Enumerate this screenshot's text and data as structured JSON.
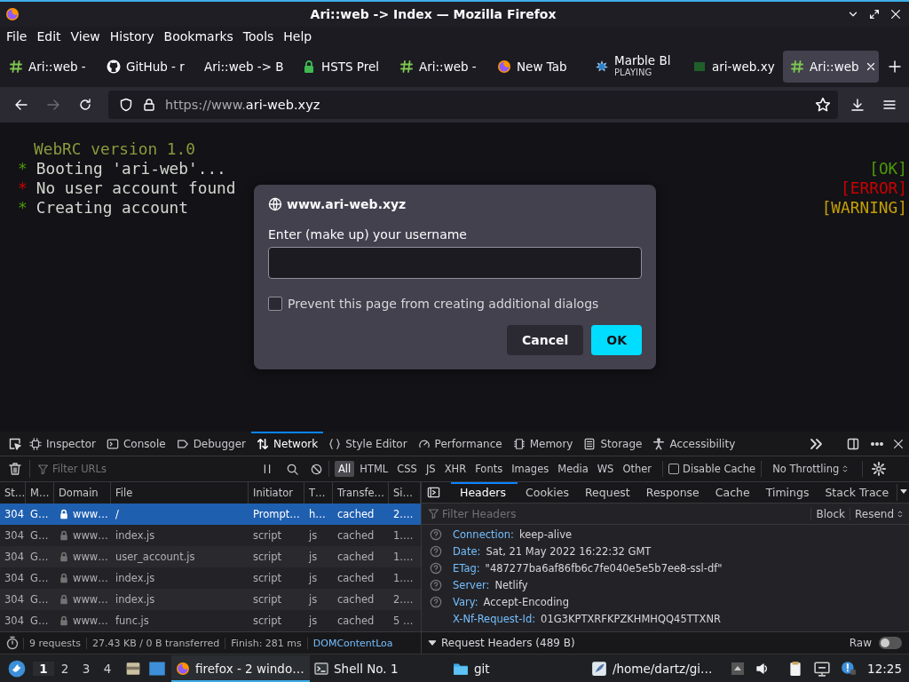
{
  "window": {
    "title": "Ari::web -> Index — Mozilla Firefox"
  },
  "menu": [
    "File",
    "Edit",
    "View",
    "History",
    "Bookmarks",
    "Tools",
    "Help"
  ],
  "tabs": [
    {
      "label": "Ari::web -",
      "kind": "hash",
      "selected": false
    },
    {
      "label": "GitHub - r",
      "kind": "github",
      "selected": false
    },
    {
      "label": "Ari::web -> B",
      "kind": "plain",
      "selected": false
    },
    {
      "label": "HSTS Prel",
      "kind": "lock",
      "selected": false
    },
    {
      "label": "Ari::web -",
      "kind": "hash",
      "selected": false
    },
    {
      "label": "New Tab",
      "kind": "firefox",
      "selected": false
    },
    {
      "label": "Marble Bl",
      "sublabel": "PLAYING",
      "kind": "marble",
      "selected": false
    },
    {
      "label": "ari-web.xy",
      "kind": "square",
      "selected": false
    },
    {
      "label": "Ari::web",
      "kind": "hash",
      "selected": true
    }
  ],
  "address": {
    "prefix": "https://www.",
    "host": "ari-web.xyz"
  },
  "console": {
    "heading": "WebRC version 1.0",
    "lines": [
      {
        "bullet": "*",
        "kind": "ok",
        "text": "Booting 'ari-web'...",
        "status": "[OK]",
        "color": "#4e9a06"
      },
      {
        "bullet": "*",
        "kind": "error",
        "text": "No user account found",
        "status": "[ERROR]",
        "color": "#cc0000"
      },
      {
        "bullet": "*",
        "kind": "ok",
        "text": "Creating account",
        "status": "[WARNING]",
        "color": "#c4a000"
      }
    ]
  },
  "dialog": {
    "origin": "www.ari-web.xyz",
    "label": "Enter (make up) your username",
    "checkbox": {
      "label": "Prevent this page from creating additional dialogs",
      "checked": false
    },
    "buttons": [
      {
        "label": "Cancel",
        "kind": "secondary"
      },
      {
        "label": "OK",
        "kind": "primary"
      }
    ]
  },
  "devtools": {
    "tabs": [
      {
        "label": "Inspector",
        "kind": "inspector",
        "selected": false
      },
      {
        "label": "Console",
        "kind": "console",
        "selected": false
      },
      {
        "label": "Debugger",
        "kind": "debugger",
        "selected": false
      },
      {
        "label": "Network",
        "kind": "network",
        "selected": true
      },
      {
        "label": "Style Editor",
        "kind": "style",
        "selected": false
      },
      {
        "label": "Performance",
        "kind": "performance",
        "selected": false
      },
      {
        "label": "Memory",
        "kind": "memory",
        "selected": false
      },
      {
        "label": "Storage",
        "kind": "storage",
        "selected": false
      },
      {
        "label": "Accessibility",
        "kind": "accessibility",
        "selected": false
      }
    ],
    "network": {
      "filter": {
        "placeholder": "Filter URLs"
      },
      "types": [
        {
          "label": "All",
          "selected": true
        },
        {
          "label": "HTML",
          "selected": false
        },
        {
          "label": "CSS",
          "selected": false
        },
        {
          "label": "JS",
          "selected": false
        },
        {
          "label": "XHR",
          "selected": false
        },
        {
          "label": "Fonts",
          "selected": false
        },
        {
          "label": "Images",
          "selected": false
        },
        {
          "label": "Media",
          "selected": false
        },
        {
          "label": "WS",
          "selected": false
        },
        {
          "label": "Other",
          "selected": false
        }
      ],
      "disable_cache": {
        "label": "Disable Cache",
        "checked": false
      },
      "throttling": "No Throttling",
      "columns": [
        "St…",
        "M…",
        "Domain",
        "File",
        "Initiator",
        "T…",
        "Transfe…",
        "Si…"
      ],
      "rows": [
        {
          "status": "304",
          "method": "G…",
          "domain": "www…",
          "file": "/",
          "initiator": "Prompt…",
          "type": "h…",
          "transferred": "cached",
          "size": "2.…",
          "selected": true
        },
        {
          "status": "304",
          "method": "G…",
          "domain": "www…",
          "file": "index.js",
          "initiator": "script",
          "type": "js",
          "transferred": "cached",
          "size": "1.…",
          "selected": false
        },
        {
          "status": "304",
          "method": "G…",
          "domain": "www…",
          "file": "user_account.js",
          "initiator": "script",
          "type": "js",
          "transferred": "cached",
          "size": "1.…",
          "selected": false
        },
        {
          "status": "304",
          "method": "G…",
          "domain": "www…",
          "file": "index.js",
          "initiator": "script",
          "type": "js",
          "transferred": "cached",
          "size": "1.…",
          "selected": false
        },
        {
          "status": "304",
          "method": "G…",
          "domain": "www…",
          "file": "index.js",
          "initiator": "script",
          "type": "js",
          "transferred": "cached",
          "size": "2.…",
          "selected": false
        },
        {
          "status": "304",
          "method": "G…",
          "domain": "www…",
          "file": "func.js",
          "initiator": "script",
          "type": "js",
          "transferred": "cached",
          "size": "5 …",
          "selected": false
        }
      ],
      "summary": [
        "9 requests",
        "27.43 KB / 0 B transferred",
        "Finish: 281 ms",
        "DOMContentLoa"
      ],
      "details": {
        "tabs": [
          {
            "label": "Headers",
            "selected": true
          },
          {
            "label": "Cookies",
            "selected": false
          },
          {
            "label": "Request",
            "selected": false
          },
          {
            "label": "Response",
            "selected": false
          },
          {
            "label": "Cache",
            "selected": false
          },
          {
            "label": "Timings",
            "selected": false
          },
          {
            "label": "Stack Trace",
            "selected": false
          }
        ],
        "filter": {
          "placeholder": "Filter Headers"
        },
        "actions": [
          "Block",
          "Resend"
        ],
        "headers": [
          {
            "name": "Connection:",
            "value": "keep-alive",
            "help": true
          },
          {
            "name": "Date:",
            "value": "Sat, 21 May 2022 16:22:32 GMT",
            "help": true
          },
          {
            "name": "ETag:",
            "value": "\"487277ba6af86fb6c7fe040e5e5b7ee8-ssl-df\"",
            "help": true
          },
          {
            "name": "Server:",
            "value": "Netlify",
            "help": true
          },
          {
            "name": "Vary:",
            "value": "Accept-Encoding",
            "help": true
          },
          {
            "name": "X-Nf-Request-Id:",
            "value": "01G3KPTXRFKPZKHMHQQ45TTXNR",
            "help": false
          }
        ],
        "section": "Request Headers (489 B)",
        "raw": {
          "label": "Raw",
          "on": false
        }
      }
    }
  },
  "taskbar": {
    "workspaces": [
      {
        "label": "1",
        "selected": true
      },
      {
        "label": "2",
        "selected": false
      },
      {
        "label": "3",
        "selected": false
      },
      {
        "label": "4",
        "selected": false
      }
    ],
    "tasks": [
      {
        "label": "firefox - 2 windo…",
        "kind": "firefox",
        "selected": true
      },
      {
        "label": "Shell No. 1",
        "kind": "terminal",
        "selected": false
      },
      {
        "label": "git",
        "kind": "folder",
        "selected": false
      },
      {
        "label": "/home/dartz/gi…",
        "kind": "editor",
        "selected": false
      }
    ],
    "clock": "12:25"
  }
}
